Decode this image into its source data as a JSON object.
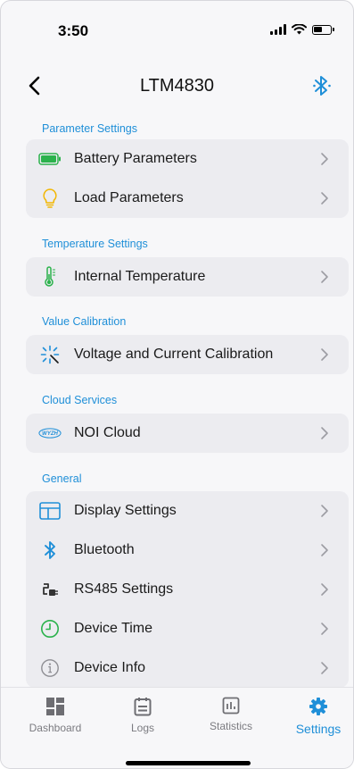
{
  "status": {
    "time": "3:50"
  },
  "nav": {
    "title": "LTM4830"
  },
  "sections": {
    "parameter": {
      "header": "Parameter Settings",
      "items": [
        "Battery Parameters",
        "Load Parameters"
      ]
    },
    "temperature": {
      "header": "Temperature Settings",
      "items": [
        "Internal Temperature"
      ]
    },
    "calibration": {
      "header": "Value Calibration",
      "items": [
        "Voltage and Current Calibration"
      ]
    },
    "cloud": {
      "header": "Cloud Services",
      "items": [
        "NOI Cloud"
      ],
      "logo_text": "WYZH"
    },
    "general": {
      "header": "General",
      "items": [
        "Display Settings",
        "Bluetooth",
        "RS485 Settings",
        "Device Time",
        "Device Info"
      ]
    }
  },
  "tabs": [
    {
      "label": "Dashboard",
      "icon": "dashboard-icon"
    },
    {
      "label": "Logs",
      "icon": "logs-icon"
    },
    {
      "label": "Statistics",
      "icon": "statistics-icon"
    },
    {
      "label": "Settings",
      "icon": "gear-icon",
      "active": true
    }
  ],
  "colors": {
    "accent": "#1f8fd8",
    "battery_green": "#2bb24c",
    "bulb_yellow": "#f2b705",
    "thermo_green": "#2bb24c"
  }
}
